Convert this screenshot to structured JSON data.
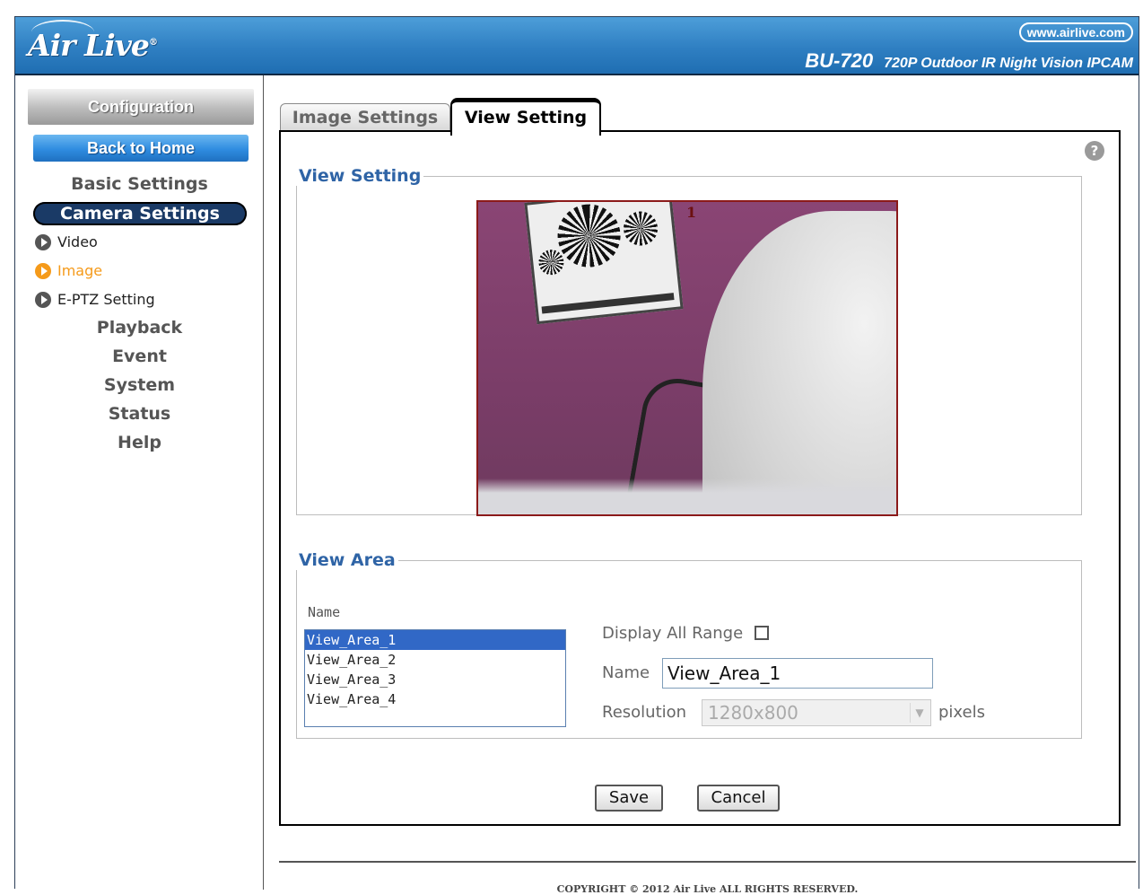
{
  "header": {
    "logo": "Air Live",
    "logo_mark": "®",
    "url": "www.airlive.com",
    "model": "BU-720",
    "model_desc": "720P Outdoor IR Night Vision IPCAM"
  },
  "sidebar": {
    "configuration": "Configuration",
    "back_home": "Back to Home",
    "basic_settings": "Basic Settings",
    "camera_settings": "Camera Settings",
    "sub_items": [
      {
        "label": "Video",
        "icon": "play-circle-icon"
      },
      {
        "label": "Image",
        "icon": "play-circle-icon"
      },
      {
        "label": "E-PTZ Setting",
        "icon": "play-circle-icon"
      }
    ],
    "sections": [
      "Playback",
      "Event",
      "System",
      "Status",
      "Help"
    ]
  },
  "tabs": [
    "Image Settings",
    "View Setting"
  ],
  "view_setting": {
    "legend": "View Setting",
    "area_number": "1"
  },
  "view_area": {
    "legend": "View Area",
    "name_header": "Name",
    "items": [
      "View_Area_1",
      "View_Area_2",
      "View_Area_3",
      "View_Area_4"
    ],
    "display_all_range_label": "Display All Range",
    "name_label": "Name",
    "name_value": "View_Area_1",
    "resolution_label": "Resolution",
    "resolution_value": "1280x800",
    "pixels_label": "pixels"
  },
  "buttons": {
    "save": "Save",
    "cancel": "Cancel"
  },
  "footer": "COPYRIGHT © 2012 Air Live ALL RIGHTS RESERVED.",
  "colors": {
    "accent": "#2f64a6",
    "active_item": "#f59a1a",
    "header": "#2f7fc2"
  }
}
